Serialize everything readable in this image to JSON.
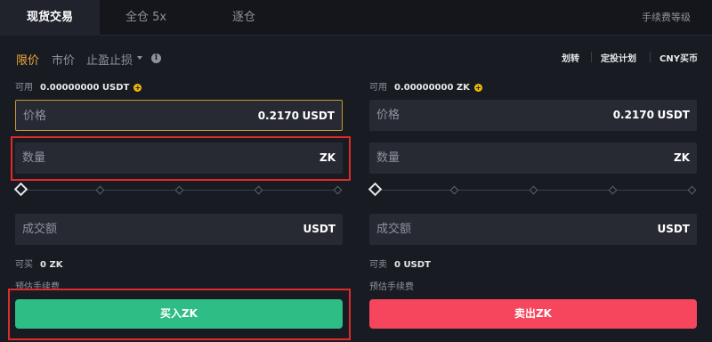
{
  "tabs": [
    {
      "label": "现货交易",
      "active": true
    },
    {
      "label": "全仓 5x",
      "active": false
    },
    {
      "label": "逐仓",
      "active": false
    }
  ],
  "fee_level": "手续费等级",
  "order_types": {
    "limit": "限价",
    "market": "市价",
    "stop": "止盈止损",
    "active": "limit"
  },
  "right_links": {
    "transfer": "划转",
    "dca": "定投计划",
    "cny": "CNY买币"
  },
  "buy": {
    "available_label": "可用",
    "available_value": "0.00000000 USDT",
    "price_label": "价格",
    "price_value": "0.2170",
    "price_unit": "USDT",
    "qty_label": "数量",
    "qty_unit": "ZK",
    "total_label": "成交额",
    "total_unit": "USDT",
    "can_label": "可买",
    "can_value": "0 ZK",
    "fee_label": "预估手续费",
    "button_label": "买入ZK"
  },
  "sell": {
    "available_label": "可用",
    "available_value": "0.00000000 ZK",
    "price_label": "价格",
    "price_value": "0.2170",
    "price_unit": "USDT",
    "qty_label": "数量",
    "qty_unit": "ZK",
    "total_label": "成交额",
    "total_unit": "USDT",
    "can_label": "可卖",
    "can_value": "0 USDT",
    "fee_label": "预估手续费",
    "button_label": "卖出ZK"
  },
  "slider": {
    "value_percent": 0,
    "steps": [
      0,
      25,
      50,
      75,
      100
    ]
  },
  "colors": {
    "accent": "#f0a93b",
    "buy": "#2ebd85",
    "sell": "#f6465d",
    "highlight": "#e02b2b",
    "background": "#181b21"
  },
  "icons": {
    "info": "info-circle-icon",
    "deposit": "plus-circle-icon",
    "dropdown": "chevron-down-icon"
  }
}
